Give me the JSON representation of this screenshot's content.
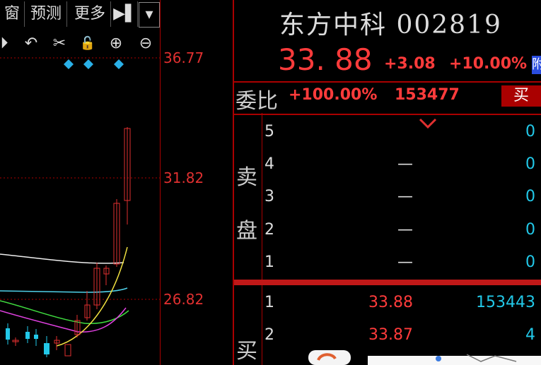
{
  "toolbar": {
    "buttons": [
      "窗",
      "预测",
      "更多",
      "▶▌",
      "▾"
    ]
  },
  "icons": [
    "play-circle-icon",
    "undo-icon",
    "scissors-icon",
    "lock-icon",
    "zoom-in-icon",
    "zoom-out-icon"
  ],
  "icon_glyphs": [
    "⏵",
    "↶",
    "✂",
    "🔓",
    "⊕",
    "⊖"
  ],
  "price_axis": [
    "36.77",
    "31.82",
    "26.82"
  ],
  "quote": {
    "name": "东方中科 002819",
    "last": "33. 88",
    "change": "+3.08",
    "change_pct": "+10.00%",
    "side_tag": "附",
    "weibi_label": "委比",
    "weibi_pct": "+100.00%",
    "weibi_val": "153477",
    "buy_label": "买",
    "sell_label": "卖\n盘",
    "sell_label_1": "卖",
    "sell_label_2": "盘",
    "buy_side_label": "买"
  },
  "sell_levels": [
    {
      "lvl": "5",
      "price": "",
      "vol": "0"
    },
    {
      "lvl": "4",
      "price": "—",
      "vol": "0"
    },
    {
      "lvl": "3",
      "price": "—",
      "vol": "0"
    },
    {
      "lvl": "2",
      "price": "—",
      "vol": "0"
    },
    {
      "lvl": "1",
      "price": "—",
      "vol": "0"
    }
  ],
  "buy_levels": [
    {
      "lvl": "1",
      "price": "33.88",
      "vol": "153443"
    },
    {
      "lvl": "2",
      "price": "33.87",
      "vol": "4"
    }
  ],
  "colors": {
    "up": "#ff3b3b",
    "down": "#22c8e8",
    "accent_red": "#a00000"
  }
}
